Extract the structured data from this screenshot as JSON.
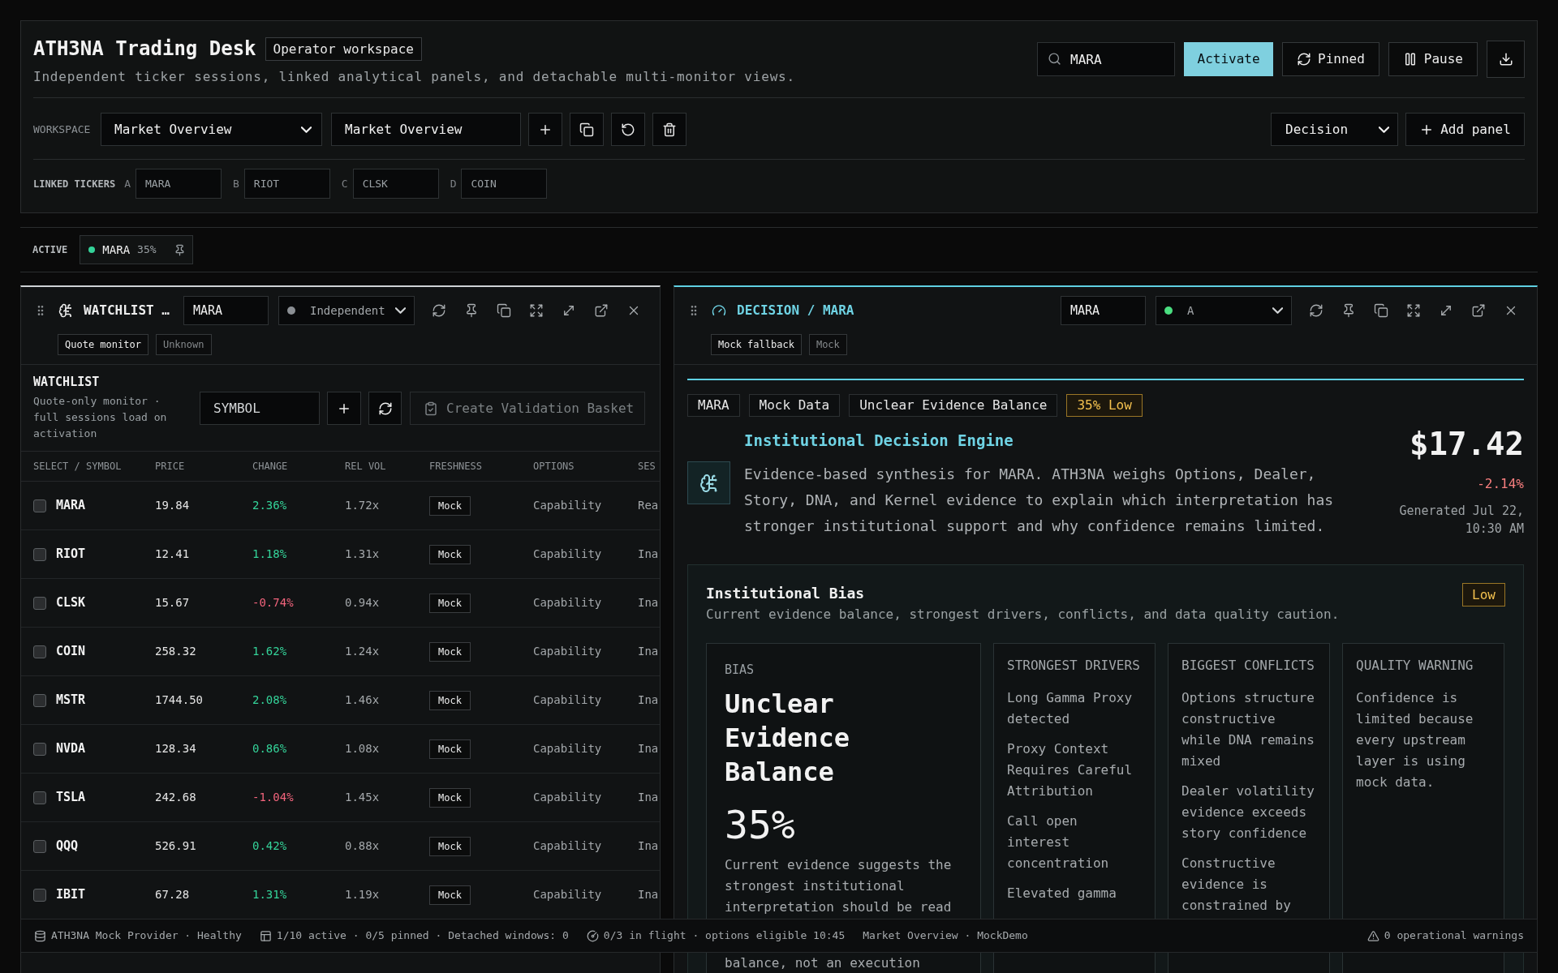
{
  "header": {
    "title": "ATH3NA Trading Desk",
    "badge": "Operator workspace",
    "subtitle": "Independent ticker sessions, linked analytical panels, and detachable multi-monitor views.",
    "search": {
      "value": "MARA"
    },
    "actions": [
      {
        "kind": "primary",
        "label": "Activate"
      },
      {
        "kind": "outline",
        "label": "Pinned"
      },
      {
        "kind": "outline",
        "label": "Pause"
      },
      {
        "kind": "icon"
      }
    ]
  },
  "workspace": {
    "label": "WORKSPACE",
    "selected": "Market Overview",
    "name": "Market Overview",
    "panel_type": "Decision",
    "add_label": "Add panel"
  },
  "linked_tickers": {
    "label": "LINKED TICKERS",
    "slots": [
      {
        "letter": "A",
        "value": "MARA"
      },
      {
        "letter": "B",
        "value": "RIOT"
      },
      {
        "letter": "C",
        "value": "CLSK"
      },
      {
        "letter": "D",
        "value": "COIN"
      }
    ]
  },
  "active": {
    "label": "ACTIVE",
    "sessions": [
      {
        "symbol": "MARA",
        "confidence": "35%",
        "color": "#34d399"
      }
    ]
  },
  "watchlist_panel": {
    "focused": false,
    "title": "WATCHLIST …",
    "ticker": "MARA",
    "link": {
      "label": "Independent",
      "color": "#8b8f94"
    },
    "tags": [
      {
        "label": "Quote monitor",
        "muted": false
      },
      {
        "label": "Unknown",
        "muted": true
      }
    ],
    "section": {
      "title": "WATCHLIST",
      "description": "Quote-only monitor · full sessions load on activation",
      "symbol_field": {
        "placeholder": "SYMBOL"
      },
      "basket_button": {
        "label": "Create Validation Basket",
        "disabled": true
      }
    },
    "columns": [
      "SELECT / SYMBOL",
      "PRICE",
      "CHANGE",
      "REL VOL",
      "FRESHNESS",
      "OPTIONS",
      "SES"
    ],
    "rows": [
      {
        "checked": false,
        "symbol": "MARA",
        "price": "19.84",
        "change": "2.36%",
        "negative": false,
        "rel_vol": "1.72x",
        "freshness": "Mock",
        "options": "Capability",
        "column_7": "Rea"
      },
      {
        "checked": false,
        "symbol": "RIOT",
        "price": "12.41",
        "change": "1.18%",
        "negative": false,
        "rel_vol": "1.31x",
        "freshness": "Mock",
        "options": "Capability",
        "column_7": "Ina"
      },
      {
        "checked": false,
        "symbol": "CLSK",
        "price": "15.67",
        "change": "-0.74%",
        "negative": true,
        "rel_vol": "0.94x",
        "freshness": "Mock",
        "options": "Capability",
        "column_7": "Ina"
      },
      {
        "checked": false,
        "symbol": "COIN",
        "price": "258.32",
        "change": "1.62%",
        "negative": false,
        "rel_vol": "1.24x",
        "freshness": "Mock",
        "options": "Capability",
        "column_7": "Ina"
      },
      {
        "checked": false,
        "symbol": "MSTR",
        "price": "1744.50",
        "change": "2.08%",
        "negative": false,
        "rel_vol": "1.46x",
        "freshness": "Mock",
        "options": "Capability",
        "column_7": "Ina"
      },
      {
        "checked": false,
        "symbol": "NVDA",
        "price": "128.34",
        "change": "0.86%",
        "negative": false,
        "rel_vol": "1.08x",
        "freshness": "Mock",
        "options": "Capability",
        "column_7": "Ina"
      },
      {
        "checked": false,
        "symbol": "TSLA",
        "price": "242.68",
        "change": "-1.04%",
        "negative": true,
        "rel_vol": "1.45x",
        "freshness": "Mock",
        "options": "Capability",
        "column_7": "Ina"
      },
      {
        "checked": false,
        "symbol": "QQQ",
        "price": "526.91",
        "change": "0.42%",
        "negative": false,
        "rel_vol": "0.88x",
        "freshness": "Mock",
        "options": "Capability",
        "column_7": "Ina"
      },
      {
        "checked": false,
        "symbol": "IBIT",
        "price": "67.28",
        "change": "1.31%",
        "negative": false,
        "rel_vol": "1.19x",
        "freshness": "Mock",
        "options": "Capability",
        "column_7": "Ina"
      }
    ]
  },
  "decision_panel": {
    "focused": true,
    "title": "DECISION / MARA",
    "ticker": "MARA",
    "link": {
      "label": "A",
      "color": "#4ade80"
    },
    "tags": [
      {
        "label": "Mock fallback",
        "muted": false
      },
      {
        "label": "Mock",
        "muted": true
      }
    ],
    "chips": [
      {
        "label": "MARA",
        "kind": "neutral"
      },
      {
        "label": "Mock Data",
        "kind": "neutral"
      },
      {
        "label": "Unclear Evidence Balance",
        "kind": "neutral"
      },
      {
        "label": "35% Low",
        "kind": "warning"
      }
    ],
    "engine": {
      "title": "Institutional Decision Engine",
      "description": "Evidence-based synthesis for MARA. ATH3NA weighs Options, Dealer, Story, DNA, and Kernel evidence to explain which interpretation has stronger institutional support and why confidence remains limited."
    },
    "quote": {
      "price": "$17.42",
      "change": "-2.14%",
      "negative": true,
      "generated": "Generated Jul 22, 10:30 AM"
    },
    "bias_card": {
      "title": "Institutional Bias",
      "subtitle": "Current evidence balance, strongest drivers, conflicts, and data quality caution.",
      "badge": {
        "label": "Low",
        "kind": "warning"
      },
      "bias": {
        "label": "BIAS",
        "value": "Unclear Evidence Balance",
        "confidence": "35%",
        "description": [
          "Current evidence suggests the strongest institutional interpretation should be read",
          "balance, not an execution"
        ]
      },
      "columns": [
        {
          "heading": "STRONGEST DRIVERS",
          "items": [
            "Long Gamma Proxy detected",
            "Proxy Context Requires Careful Attribution",
            "Call open interest concentration",
            "Elevated gamma"
          ]
        },
        {
          "heading": "BIGGEST CONFLICTS",
          "items": [
            "Options structure constructive while DNA remains mixed",
            "Dealer volatility evidence exceeds story confidence",
            "Constructive evidence is constrained by"
          ]
        },
        {
          "heading": "QUALITY WARNING",
          "items": [
            "Confidence is limited because every upstream layer is using mock data."
          ]
        }
      ]
    }
  },
  "status_bar": {
    "items": [
      "ATH3NA Mock Provider · Healthy",
      "1/10 active · 0/5 pinned · Detached windows: 0",
      "0/3 in flight · options eligible 10:45",
      "Market Overview · MockDemo"
    ],
    "warnings": "0 operational warnings"
  }
}
